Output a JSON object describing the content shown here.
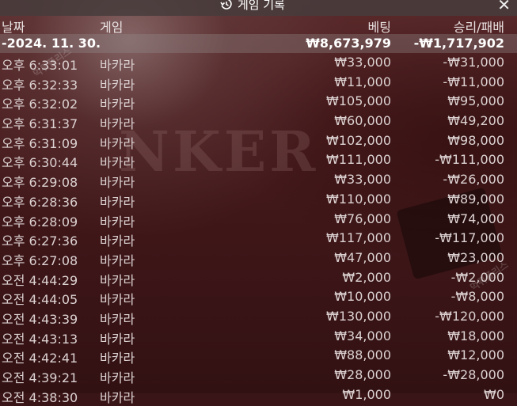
{
  "window": {
    "title": "게임 기록",
    "close_glyph": "✕",
    "history_icon": "history-icon"
  },
  "columns": {
    "date": "날짜",
    "game": "게임",
    "bet": "베팅",
    "result": "승리/패배"
  },
  "summary": {
    "date": "-2024. 11. 30.",
    "bet": "₩8,673,979",
    "result": "-₩1,717,902"
  },
  "background": {
    "word": "NKER"
  },
  "watermarks": [
    "먹튀폴리스",
    "먹튀폴리스"
  ],
  "rows": [
    {
      "time": "오후 6:33:01",
      "game": "바카라",
      "bet": "₩33,000",
      "result": "-₩31,000"
    },
    {
      "time": "오후 6:32:33",
      "game": "바카라",
      "bet": "₩11,000",
      "result": "-₩11,000"
    },
    {
      "time": "오후 6:32:02",
      "game": "바카라",
      "bet": "₩105,000",
      "result": "₩95,000"
    },
    {
      "time": "오후 6:31:37",
      "game": "바카라",
      "bet": "₩60,000",
      "result": "₩49,200"
    },
    {
      "time": "오후 6:31:09",
      "game": "바카라",
      "bet": "₩102,000",
      "result": "₩98,000"
    },
    {
      "time": "오후 6:30:44",
      "game": "바카라",
      "bet": "₩111,000",
      "result": "-₩111,000"
    },
    {
      "time": "오후 6:29:08",
      "game": "바카라",
      "bet": "₩33,000",
      "result": "-₩26,000"
    },
    {
      "time": "오후 6:28:36",
      "game": "바카라",
      "bet": "₩110,000",
      "result": "₩89,000"
    },
    {
      "time": "오후 6:28:09",
      "game": "바카라",
      "bet": "₩76,000",
      "result": "₩74,000"
    },
    {
      "time": "오후 6:27:36",
      "game": "바카라",
      "bet": "₩117,000",
      "result": "-₩117,000"
    },
    {
      "time": "오후 6:27:08",
      "game": "바카라",
      "bet": "₩47,000",
      "result": "₩23,000"
    },
    {
      "time": "오전 4:44:29",
      "game": "바카라",
      "bet": "₩2,000",
      "result": "-₩2,000"
    },
    {
      "time": "오전 4:44:05",
      "game": "바카라",
      "bet": "₩10,000",
      "result": "-₩8,000"
    },
    {
      "time": "오전 4:43:39",
      "game": "바카라",
      "bet": "₩130,000",
      "result": "-₩120,000"
    },
    {
      "time": "오전 4:43:13",
      "game": "바카라",
      "bet": "₩34,000",
      "result": "₩18,000"
    },
    {
      "time": "오전 4:42:41",
      "game": "바카라",
      "bet": "₩88,000",
      "result": "₩12,000"
    },
    {
      "time": "오전 4:39:21",
      "game": "바카라",
      "bet": "₩28,000",
      "result": "-₩28,000"
    },
    {
      "time": "오전 4:38:30",
      "game": "바카라",
      "bet": "₩1,000",
      "result": "₩0"
    }
  ]
}
